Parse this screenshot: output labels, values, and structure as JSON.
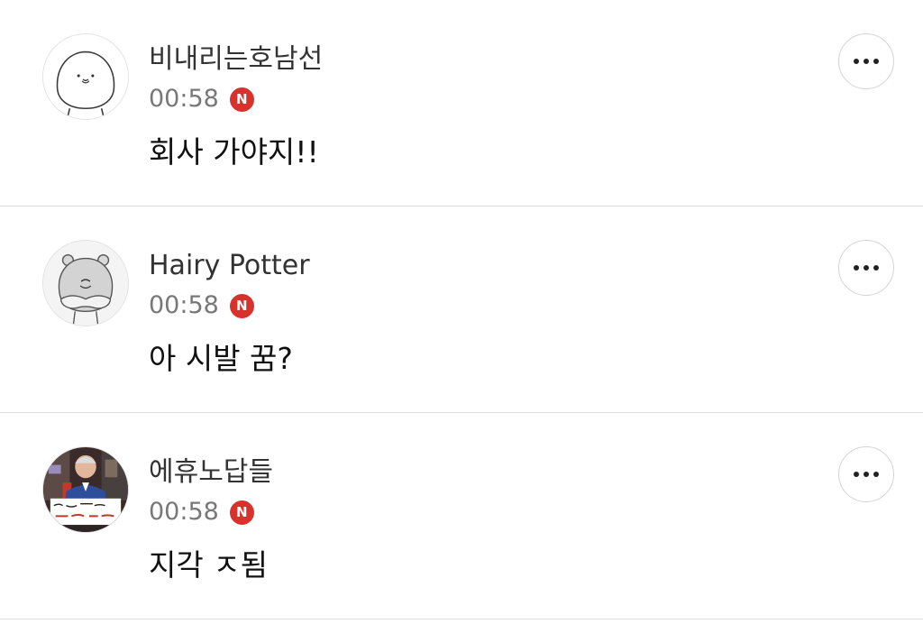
{
  "comments": [
    {
      "nickname": "비내리는호남선",
      "time": "00:58",
      "badge": "N",
      "text": "회사 가야지!!",
      "avatar_icon": "white-blob-character-icon"
    },
    {
      "nickname": "Hairy Potter",
      "time": "00:58",
      "badge": "N",
      "text": "아 시발 꿈?",
      "avatar_icon": "gray-hamster-character-icon"
    },
    {
      "nickname": "에휴노답들",
      "time": "00:58",
      "badge": "N",
      "text": "지각 ㅈ됨",
      "avatar_icon": "man-with-protest-sign-photo"
    }
  ],
  "colors": {
    "badge": "#d7332c",
    "divider": "#dddddd",
    "time": "#787878",
    "nickname": "#333333"
  }
}
